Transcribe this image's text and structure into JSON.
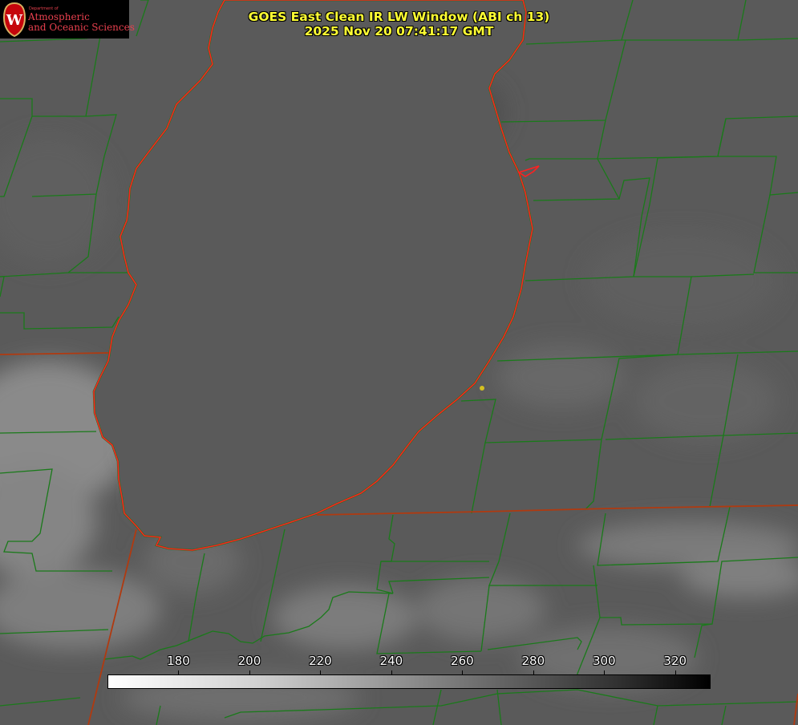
{
  "title_line1": "GOES East Clean IR LW Window (ABI ch 13)",
  "title_line2": "2025 Nov 20 07:41:17 GMT",
  "logo": {
    "small_text": "Department of",
    "line1": "Atmospheric",
    "line2": "and Oceanic Sciences",
    "crest_letter": "W"
  },
  "colorbar": {
    "min": 160,
    "max": 330,
    "ticks": [
      180,
      200,
      220,
      240,
      260,
      280,
      300,
      320
    ]
  },
  "colors": {
    "title": "#ffff33",
    "county_lines": "#1a7a1a",
    "state_lines": "#b03a10",
    "lake_shore": "#ff2020",
    "marker": "#d4c020"
  }
}
